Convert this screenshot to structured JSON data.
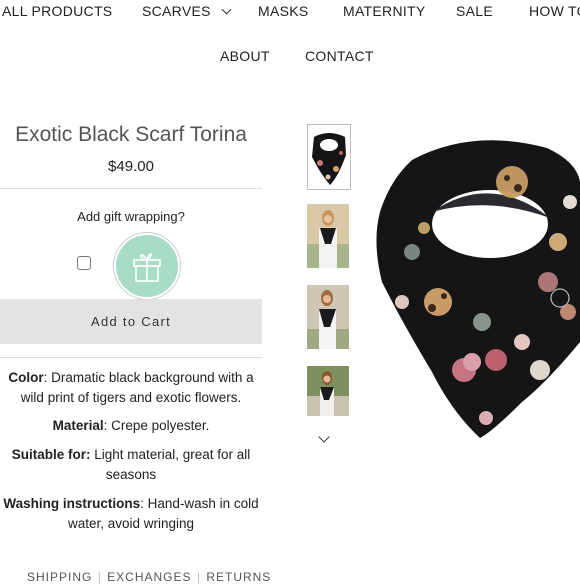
{
  "nav": {
    "all_products": "ALL PRODUCTS",
    "scarves": "SCARVES",
    "masks": "MASKS",
    "maternity": "MATERNITY",
    "sale": "SALE",
    "how_to": "HOW TO",
    "about": "ABOUT",
    "contact": "CONTACT"
  },
  "product": {
    "title": "Exotic Black Scarf Torina",
    "price": "$49.00",
    "gift_label": "Add gift wrapping?",
    "gift_icon": "gift-box-icon",
    "add_to_cart": "Add to Cart",
    "details": [
      {
        "label": "Color",
        "text": ": Dramatic black background with a wild print of tigers and exotic flowers."
      },
      {
        "label": "Material",
        "text": ": Crepe polyester."
      },
      {
        "label": "Suitable for:",
        "text": " Light material, great for all seasons"
      },
      {
        "label": "Washing instructions",
        "text": ": Hand-wash in cold water, avoid wringing"
      }
    ]
  },
  "tabs": [
    "SHIPPING",
    "EXCHANGES",
    "RETURNS"
  ],
  "thumbnails": [
    "scarf-thumbnail",
    "model-front-thumbnail",
    "model-side-thumbnail",
    "model-outdoor-thumbnail"
  ],
  "colors": {
    "gift_circle": "#a8dcc7",
    "button_bg": "#e3e3e3",
    "scarf_black": "#151518"
  }
}
